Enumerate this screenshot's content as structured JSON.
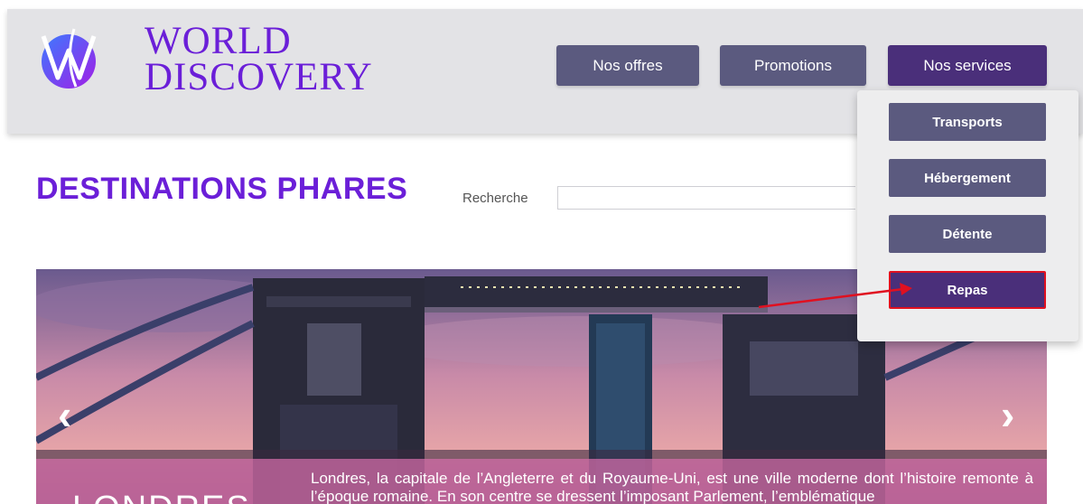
{
  "brand": {
    "line1": "WORLD",
    "line2": "DISCOVERY"
  },
  "nav": {
    "offers": "Nos offres",
    "promotions": "Promotions",
    "services": "Nos services"
  },
  "dropdown": {
    "items": [
      "Transports",
      "Hébergement",
      "Détente",
      "Repas"
    ]
  },
  "page": {
    "title": "DESTINATIONS PHARES"
  },
  "search": {
    "label": "Recherche",
    "value": ""
  },
  "hero": {
    "city": "LONDRES",
    "description": "Londres, la capitale de l’Angleterre et du Royaume-Uni, est une ville moderne dont l’histoire remonte à l’époque romaine. En son centre se dressent l’imposant Parlement, l’emblématique",
    "prev": "‹",
    "next": "›"
  },
  "colors": {
    "brand": "#6b1fd8",
    "nav_button": "#5b5a7f",
    "nav_active": "#4a2f7a",
    "highlight_border": "#e01020",
    "caption_overlay": "#d66eaa"
  }
}
